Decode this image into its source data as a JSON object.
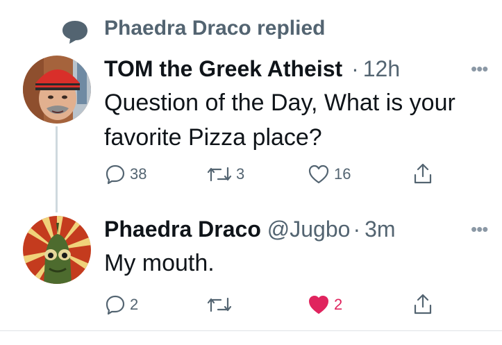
{
  "context": {
    "icon": "speech-bubble-icon",
    "text": "Phaedra Draco replied"
  },
  "tweets": [
    {
      "name": "TOM the Greek Atheist",
      "handle": "",
      "separator": "·",
      "time": "12h",
      "more": "•••",
      "text_lines": [
        "Question of the Day, What is your",
        "favorite Pizza place?"
      ],
      "actions": {
        "reply": "38",
        "retweet": "3",
        "like": "16",
        "share": ""
      },
      "liked": false
    },
    {
      "name": "Phaedra Draco",
      "handle": "@Jugbo",
      "separator": "·",
      "time": "3m",
      "more": "•••",
      "text_lines": [
        "My mouth."
      ],
      "actions": {
        "reply": "2",
        "retweet": "",
        "like": "2",
        "share": ""
      },
      "liked": true
    }
  ],
  "colors": {
    "text": "#0f1419",
    "secondary": "#536471",
    "like": "#e0245e",
    "thread_line": "#cfd9de"
  }
}
